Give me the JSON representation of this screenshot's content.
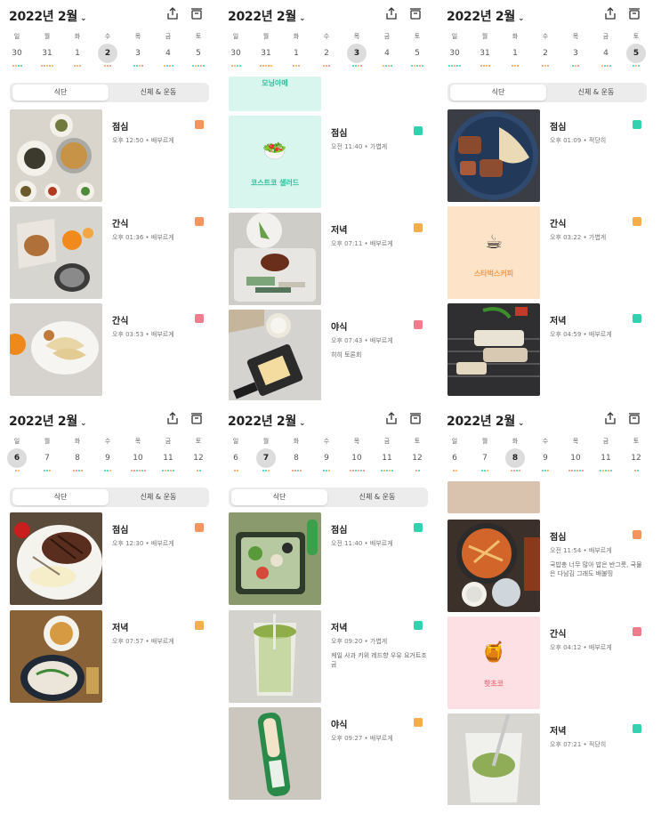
{
  "colors": {
    "orange": "#f4955e",
    "amber": "#f5ac4a",
    "pink": "#ef7d8c",
    "mint": "#33d1b0",
    "selected_day_bg": "#dcdcdc",
    "mint_card_bg": "#d8f6ee",
    "peach_card_bg": "#fde3c8",
    "pink_card_bg": "#fde0e4"
  },
  "panels": [
    {
      "title": "2022년 2월",
      "chevron": "⌄",
      "weekday_names": [
        "일",
        "월",
        "화",
        "수",
        "목",
        "금",
        "토"
      ],
      "days": [
        {
          "num": "30",
          "selected": false,
          "dots": [
            "#f4955e",
            "#f5ac4a",
            "#33d1b0",
            "#33d1b0"
          ]
        },
        {
          "num": "31",
          "selected": false,
          "dots": [
            "#f4955e",
            "#f4955e",
            "#f5ac4a",
            "#f4955e",
            "#f5ac4a"
          ]
        },
        {
          "num": "1",
          "selected": false,
          "dots": [
            "#f4955e",
            "#f5ac4a",
            "#f4955e"
          ]
        },
        {
          "num": "2",
          "selected": true,
          "dots": [
            "#f4955e",
            "#f4955e",
            "#ef7d8c"
          ]
        },
        {
          "num": "3",
          "selected": false,
          "dots": [
            "#33d1b0",
            "#33d1b0",
            "#f5ac4a",
            "#ef7d8c"
          ]
        },
        {
          "num": "4",
          "selected": false,
          "dots": [
            "#f5ac4a",
            "#33d1b0",
            "#f4955e",
            "#33d1b0"
          ]
        },
        {
          "num": "5",
          "selected": false,
          "dots": [
            "#33d1b0",
            "#f5ac4a",
            "#33d1b0",
            "#f4955e",
            "#33d1b0"
          ]
        }
      ],
      "seg_tabs": {
        "diet": "식단",
        "body": "신체 & 운동"
      },
      "entries": [
        {
          "meal": "점심",
          "time": "오후 12:50",
          "amount": "배부르게",
          "memo": "",
          "tag": "#f4955e",
          "thumb": "spread"
        },
        {
          "meal": "간식",
          "time": "오후 01:36",
          "amount": "배부르게",
          "memo": "",
          "tag": "#f4955e",
          "thumb": "snackbag"
        },
        {
          "meal": "간식",
          "time": "오후 03:53",
          "amount": "배부르게",
          "memo": "",
          "tag": "#ef7d8c",
          "thumb": "dumpling"
        }
      ]
    },
    {
      "title": "2022년 2월",
      "chevron": "⌄",
      "weekday_names": [
        "일",
        "월",
        "화",
        "수",
        "목",
        "금",
        "토"
      ],
      "days": [
        {
          "num": "30",
          "selected": false,
          "dots": [
            "#f4955e",
            "#f5ac4a",
            "#33d1b0",
            "#33d1b0"
          ]
        },
        {
          "num": "31",
          "selected": false,
          "dots": [
            "#f4955e",
            "#f4955e",
            "#f5ac4a",
            "#f4955e",
            "#f5ac4a"
          ]
        },
        {
          "num": "1",
          "selected": false,
          "dots": [
            "#f4955e",
            "#f5ac4a",
            "#f4955e"
          ]
        },
        {
          "num": "2",
          "selected": false,
          "dots": [
            "#f4955e",
            "#f4955e",
            "#ef7d8c"
          ]
        },
        {
          "num": "3",
          "selected": true,
          "dots": [
            "#33d1b0",
            "#33d1b0",
            "#f5ac4a",
            "#ef7d8c"
          ]
        },
        {
          "num": "4",
          "selected": false,
          "dots": [
            "#f5ac4a",
            "#33d1b0",
            "#f4955e",
            "#33d1b0"
          ]
        },
        {
          "num": "5",
          "selected": false,
          "dots": [
            "#33d1b0",
            "#f5ac4a",
            "#33d1b0",
            "#f4955e",
            "#33d1b0"
          ]
        }
      ],
      "top_partial": {
        "label": "모닝아메"
      },
      "entries": [
        {
          "meal": "점심",
          "time": "오전 11:40",
          "amount": "가볍게",
          "memo": "",
          "tag": "#33d1b0",
          "thumb": "placeholder",
          "ph_emoji": "🥗",
          "ph_label": "코스트코 샐러드",
          "ph_bg": "#d8f6ee",
          "ph_color": "#2bbf9c"
        },
        {
          "meal": "저녁",
          "time": "오후 07:11",
          "amount": "배부르게",
          "memo": "",
          "tag": "#f5ac4a",
          "thumb": "tray"
        },
        {
          "meal": "야식",
          "time": "오후 07:43",
          "amount": "배부르게",
          "memo": "히히 토론회",
          "tag": "#ef7d8c",
          "thumb": "toast"
        }
      ]
    },
    {
      "title": "2022년 2월",
      "chevron": "⌄",
      "weekday_names": [
        "일",
        "월",
        "화",
        "수",
        "목",
        "금",
        "토"
      ],
      "days": [
        {
          "num": "30",
          "selected": false,
          "dots": [
            "#33d1b0",
            "#33d1b0",
            "#f5ac4a",
            "#33d1b0",
            "#33d1b0"
          ]
        },
        {
          "num": "31",
          "selected": false,
          "dots": [
            "#f4955e",
            "#f4955e",
            "#f5ac4a",
            "#f4955e"
          ]
        },
        {
          "num": "1",
          "selected": false,
          "dots": [
            "#f4955e",
            "#f5ac4a",
            "#f4955e"
          ]
        },
        {
          "num": "2",
          "selected": false,
          "dots": [
            "#f4955e",
            "#f5ac4a",
            "#f4955e"
          ]
        },
        {
          "num": "3",
          "selected": false,
          "dots": [
            "#33d1b0",
            "#f5ac4a",
            "#ef7d8c"
          ]
        },
        {
          "num": "4",
          "selected": false,
          "dots": [
            "#f5ac4a",
            "#33d1b0",
            "#f4955e",
            "#33d1b0"
          ]
        },
        {
          "num": "5",
          "selected": true,
          "dots": [
            "#33d1b0",
            "#f5ac4a",
            "#33d1b0"
          ]
        }
      ],
      "seg_tabs": {
        "diet": "식단",
        "body": "신체 & 운동"
      },
      "entries": [
        {
          "meal": "점심",
          "time": "오후 01:09",
          "amount": "적당히",
          "memo": "",
          "tag": "#33d1b0",
          "thumb": "steakplate"
        },
        {
          "meal": "간식",
          "time": "오후 03:22",
          "amount": "가볍게",
          "memo": "",
          "tag": "#f5ac4a",
          "thumb": "placeholder",
          "ph_emoji": "☕",
          "ph_label": "스타벅스커피",
          "ph_bg": "#fde3c8",
          "ph_color": "#f29b4c"
        },
        {
          "meal": "저녁",
          "time": "오후 04:59",
          "amount": "배부르게",
          "memo": "",
          "tag": "#33d1b0",
          "thumb": "grill"
        }
      ]
    },
    {
      "title": "2022년 2월",
      "chevron": "⌄",
      "weekday_names": [
        "일",
        "월",
        "화",
        "수",
        "목",
        "금",
        "토"
      ],
      "days": [
        {
          "num": "6",
          "selected": true,
          "dots": [
            "#f4955e",
            "#f5ac4a"
          ]
        },
        {
          "num": "7",
          "selected": false,
          "dots": [
            "#33d1b0",
            "#33d1b0",
            "#f5ac4a"
          ]
        },
        {
          "num": "8",
          "selected": false,
          "dots": [
            "#f4955e",
            "#ef7d8c",
            "#33d1b0",
            "#f4955e"
          ]
        },
        {
          "num": "9",
          "selected": false,
          "dots": [
            "#33d1b0",
            "#33d1b0",
            "#f5ac4a"
          ]
        },
        {
          "num": "10",
          "selected": false,
          "dots": [
            "#f4955e",
            "#ef7d8c",
            "#33d1b0",
            "#f4955e",
            "#33d1b0",
            "#ef7d8c"
          ]
        },
        {
          "num": "11",
          "selected": false,
          "dots": [
            "#33d1b0",
            "#f5ac4a",
            "#33d1b0",
            "#f5ac4a",
            "#33d1b0"
          ]
        },
        {
          "num": "12",
          "selected": false,
          "dots": [
            "#f4955e",
            "#33d1b0"
          ]
        }
      ],
      "seg_tabs": {
        "diet": "식단",
        "body": "신체 & 운동"
      },
      "entries": [
        {
          "meal": "점심",
          "time": "오후 12:30",
          "amount": "배부르게",
          "memo": "",
          "tag": "#f4955e",
          "thumb": "steak"
        },
        {
          "meal": "저녁",
          "time": "오후 07:57",
          "amount": "배부르게",
          "memo": "",
          "tag": "#f5ac4a",
          "thumb": "noodle"
        }
      ]
    },
    {
      "title": "2022년 2월",
      "chevron": "⌄",
      "weekday_names": [
        "일",
        "월",
        "화",
        "수",
        "목",
        "금",
        "토"
      ],
      "days": [
        {
          "num": "6",
          "selected": false,
          "dots": [
            "#f4955e",
            "#f5ac4a"
          ]
        },
        {
          "num": "7",
          "selected": true,
          "dots": [
            "#33d1b0",
            "#33d1b0",
            "#f5ac4a"
          ]
        },
        {
          "num": "8",
          "selected": false,
          "dots": [
            "#f4955e",
            "#ef7d8c",
            "#33d1b0",
            "#f4955e"
          ]
        },
        {
          "num": "9",
          "selected": false,
          "dots": [
            "#33d1b0",
            "#33d1b0",
            "#f5ac4a"
          ]
        },
        {
          "num": "10",
          "selected": false,
          "dots": [
            "#f4955e",
            "#ef7d8c",
            "#33d1b0",
            "#f4955e",
            "#33d1b0",
            "#ef7d8c"
          ]
        },
        {
          "num": "11",
          "selected": false,
          "dots": [
            "#33d1b0",
            "#f5ac4a",
            "#33d1b0",
            "#f5ac4a",
            "#33d1b0"
          ]
        },
        {
          "num": "12",
          "selected": false,
          "dots": [
            "#f4955e",
            "#33d1b0"
          ]
        }
      ],
      "seg_tabs": {
        "diet": "식단",
        "body": "신체 & 운동"
      },
      "entries": [
        {
          "meal": "점심",
          "time": "오전 11:40",
          "amount": "배부르게",
          "memo": "",
          "tag": "#33d1b0",
          "thumb": "salad"
        },
        {
          "meal": "저녁",
          "time": "오후 09:20",
          "amount": "가볍게",
          "memo": "케일 사과 키위 레드향 우유 요거트조금",
          "tag": "#33d1b0",
          "thumb": "smoothie"
        },
        {
          "meal": "야식",
          "time": "오후 09:27",
          "amount": "배부르게",
          "memo": "",
          "tag": "#f5ac4a",
          "thumb": "sausage"
        }
      ]
    },
    {
      "title": "2022년 2월",
      "chevron": "⌄",
      "weekday_names": [
        "일",
        "월",
        "화",
        "수",
        "목",
        "금",
        "토"
      ],
      "days": [
        {
          "num": "6",
          "selected": false,
          "dots": [
            "#f4955e",
            "#f5ac4a"
          ]
        },
        {
          "num": "7",
          "selected": false,
          "dots": [
            "#33d1b0",
            "#33d1b0",
            "#f5ac4a"
          ]
        },
        {
          "num": "8",
          "selected": true,
          "dots": [
            "#f4955e",
            "#ef7d8c",
            "#33d1b0",
            "#f4955e"
          ]
        },
        {
          "num": "9",
          "selected": false,
          "dots": [
            "#33d1b0",
            "#33d1b0",
            "#f5ac4a"
          ]
        },
        {
          "num": "10",
          "selected": false,
          "dots": [
            "#f4955e",
            "#ef7d8c",
            "#33d1b0",
            "#f4955e",
            "#33d1b0",
            "#ef7d8c"
          ]
        },
        {
          "num": "11",
          "selected": false,
          "dots": [
            "#33d1b0",
            "#f5ac4a",
            "#33d1b0",
            "#f5ac4a",
            "#33d1b0"
          ]
        },
        {
          "num": "12",
          "selected": false,
          "dots": [
            "#f4955e",
            "#33d1b0"
          ]
        }
      ],
      "entries": [
        {
          "meal": "점심",
          "time": "오전 11:54",
          "amount": "배부르게",
          "memo": "국밥충 너무 많아 밥은 반그릇, 국물은 다남김 그래도 배불띵",
          "tag": "#f4955e",
          "thumb": "stew"
        },
        {
          "meal": "간식",
          "time": "오후 04:12",
          "amount": "배부르게",
          "memo": "",
          "tag": "#ef7d8c",
          "thumb": "placeholder",
          "ph_emoji": "🍯",
          "ph_label": "핫초코",
          "ph_bg": "#fde0e4",
          "ph_color": "#ef7d8c"
        },
        {
          "meal": "저녁",
          "time": "오후 07:21",
          "amount": "적당히",
          "memo": "",
          "tag": "#33d1b0",
          "thumb": "greencup"
        }
      ]
    }
  ]
}
